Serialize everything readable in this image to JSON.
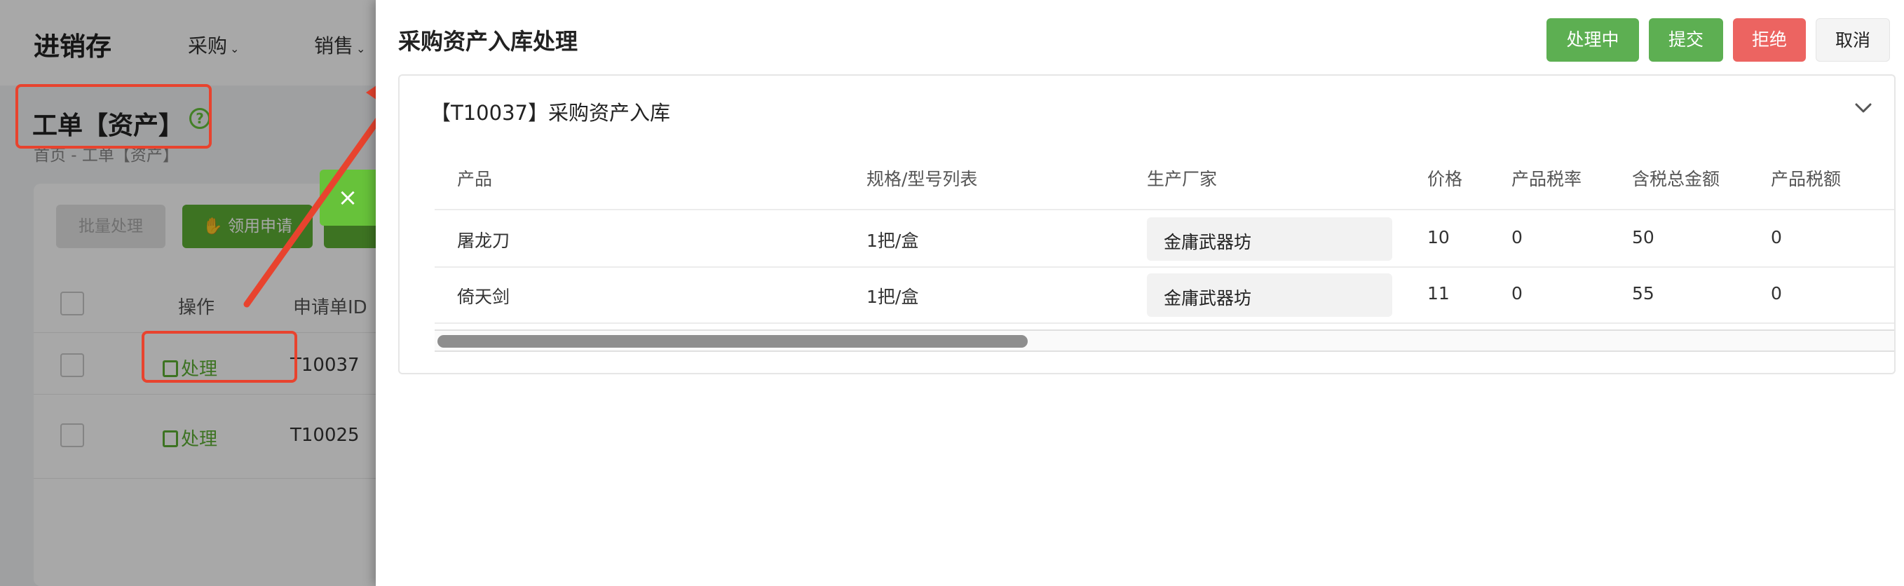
{
  "background": {
    "logo": "进销存",
    "nav": [
      "采购",
      "销售"
    ],
    "page_title": "工单【资产】",
    "breadcrumb": "首页 - 工单【资产】",
    "batch_button": "批量处理",
    "apply_button": "领用申请",
    "columns": {
      "action": "操作",
      "id": "申请单ID"
    },
    "rows": [
      {
        "action": "处理",
        "id": "T10037"
      },
      {
        "action": "处理",
        "id": "T10025"
      }
    ]
  },
  "toast": {
    "close": "×"
  },
  "drawer": {
    "title": "采购资产入库处理",
    "buttons": {
      "processing": "处理中",
      "submit": "提交",
      "reject": "拒绝",
      "cancel": "取消"
    },
    "panel": {
      "title": "【T10037】采购资产入库",
      "columns": [
        "产品",
        "规格/型号列表",
        "生产厂家",
        "价格",
        "产品税率",
        "含税总金额",
        "产品税额"
      ],
      "rows": [
        {
          "product": "屠龙刀",
          "spec": "1把/盒",
          "maker": "金庸武器坊",
          "price": "10",
          "tax_rate": "0",
          "total": "50",
          "tax": "0"
        },
        {
          "product": "倚天剑",
          "spec": "1把/盒",
          "maker": "金庸武器坊",
          "price": "11",
          "tax_rate": "0",
          "total": "55",
          "tax": "0"
        }
      ]
    }
  },
  "colors": {
    "accent_green": "#5daf52",
    "reject_red": "#ec6461",
    "annotation_red": "#e8432e"
  }
}
